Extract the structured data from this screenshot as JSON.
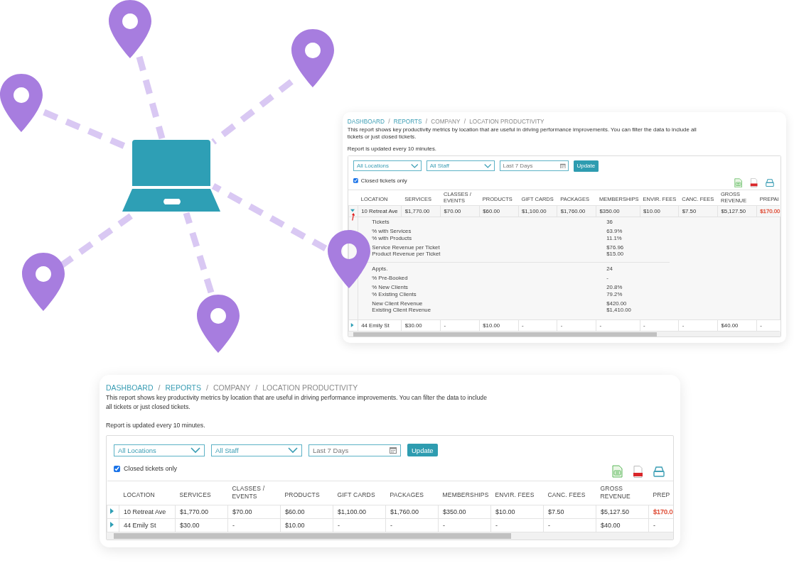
{
  "report_panels": [
    {
      "breadcrumb": [
        {
          "text": "DASHBOARD",
          "link": true
        },
        {
          "text": "REPORTS",
          "link": true
        },
        {
          "text": "COMPANY",
          "link": false
        },
        {
          "text": "LOCATION PRODUCTIVITY",
          "link": false
        }
      ],
      "breadcrumb_separator": "/",
      "description": "This report shows key productivity metrics by location that are useful in driving performance improvements. You can filter the data to include all tickets or just closed tickets.",
      "update_note": "Report is updated every 10 minutes.",
      "filters": {
        "location": "All Locations",
        "staff": "All Staff",
        "date_range": "Last 7 Days",
        "button": "Update"
      },
      "closed_only": {
        "label": "Closed tickets only",
        "checked": true
      },
      "columns": [
        "LOCATION",
        "SERVICES",
        "CLASSES / EVENTS",
        "PRODUCTS",
        "GIFT CARDS",
        "PACKAGES",
        "MEMBERSHIPS",
        "ENVIR. FEES",
        "CANC. FEES",
        "GROSS REVENUE",
        "PREPAI"
      ],
      "rows": [
        {
          "expanded": true,
          "cells": [
            "10 Retreat Ave",
            "$1,770.00",
            "$70.00",
            "$60.00",
            "$1,100.00",
            "$1,760.00",
            "$350.00",
            "$10.00",
            "$7.50",
            "$5,127.50",
            {
              "text": "$170.00",
              "color": "#e0533d"
            }
          ],
          "details": [
            [
              [
                {
                  "label": "Tickets",
                  "value": "36"
                }
              ],
              [
                {
                  "label": "% with Services",
                  "value": "63.9%"
                },
                {
                  "label": "% with Products",
                  "value": "11.1%"
                }
              ],
              [
                {
                  "label": "Service Revenue per Ticket",
                  "value": "$76.96"
                },
                {
                  "label": "Product Revenue per Ticket",
                  "value": "$15.00"
                }
              ]
            ],
            [
              [
                {
                  "label": "Appts.",
                  "value": "24"
                }
              ],
              [
                {
                  "label": "% Pre-Booked",
                  "value": "-"
                }
              ],
              [
                {
                  "label": "% New Clients",
                  "value": "20.8%"
                },
                {
                  "label": "% Existing Clients",
                  "value": "79.2%"
                }
              ],
              [
                {
                  "label": "New Client Revenue",
                  "value": "$420.00"
                },
                {
                  "label": "Existing Client Revenue",
                  "value": "$1,410.00"
                }
              ]
            ]
          ]
        },
        {
          "expanded": false,
          "cells": [
            "44 Emily St",
            "$30.00",
            "-",
            "$10.00",
            "-",
            "-",
            "-",
            "-",
            "-",
            "$40.00",
            "-"
          ]
        }
      ]
    },
    {
      "breadcrumb": [
        {
          "text": "DASHBOARD",
          "link": true
        },
        {
          "text": "REPORTS",
          "link": true
        },
        {
          "text": "COMPANY",
          "link": false
        },
        {
          "text": "LOCATION PRODUCTIVITY",
          "link": false
        }
      ],
      "breadcrumb_separator": "/",
      "description": "This report shows key productivity metrics by location that are useful in driving performance improvements. You can filter the data to include all tickets or just closed tickets.",
      "update_note": "Report is updated every 10 minutes.",
      "filters": {
        "location": "All Locations",
        "staff": "All Staff",
        "date_range": "Last 7 Days",
        "button": "Update"
      },
      "closed_only": {
        "label": "Closed tickets only",
        "checked": true
      },
      "columns": [
        "LOCATION",
        "SERVICES",
        "CLASSES / EVENTS",
        "PRODUCTS",
        "GIFT CARDS",
        "PACKAGES",
        "MEMBERSHIPS",
        "ENVIR. FEES",
        "CANC. FEES",
        "GROSS REVENUE",
        "PREP"
      ],
      "rows": [
        {
          "expanded": false,
          "cells": [
            "10 Retreat Ave",
            "$1,770.00",
            "$70.00",
            "$60.00",
            "$1,100.00",
            "$1,760.00",
            "$350.00",
            "$10.00",
            "$7.50",
            "$5,127.50",
            {
              "text": "$170.0",
              "color": "#e0533d"
            }
          ]
        },
        {
          "expanded": false,
          "cells": [
            "44 Emily St",
            "$30.00",
            "-",
            "$10.00",
            "-",
            "-",
            "-",
            "-",
            "-",
            "$40.00",
            "-"
          ]
        }
      ]
    }
  ]
}
